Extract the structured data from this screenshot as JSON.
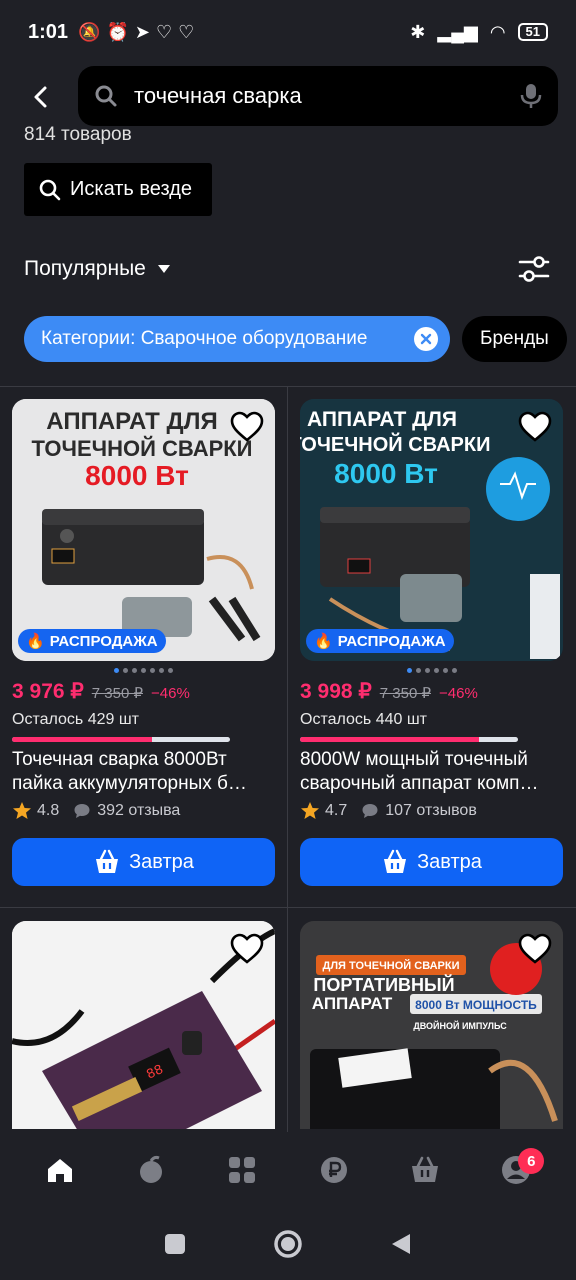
{
  "status": {
    "time": "1:01",
    "battery": "51"
  },
  "search": {
    "query": "точечная сварка"
  },
  "results": {
    "count_text": "814 товаров",
    "search_everywhere": "Искать везде"
  },
  "sort": {
    "label": "Популярные"
  },
  "chips": {
    "category": "Категории: Сварочное оборудование",
    "brands": "Бренды"
  },
  "products": [
    {
      "sale_badge": "РАСПРОДАЖА",
      "price": "3 976 ₽",
      "old_price": "7 350 ₽",
      "discount": "−46%",
      "stock": "Осталось 429 шт",
      "stock_fraction": 0.64,
      "title": "Точечная сварка 8000Вт пайка аккумуляторных б…",
      "rating": "4.8",
      "reviews": "392 отзыва",
      "buy_label": "Завтра",
      "image_text_1": "АППАРАТ ДЛЯ",
      "image_text_2": "ТОЧЕЧНОЙ СВАРКИ",
      "image_text_3": "8000 Вт",
      "image_bg": "#e8e8e8"
    },
    {
      "sale_badge": "РАСПРОДАЖА",
      "price": "3 998 ₽",
      "old_price": "7 350 ₽",
      "discount": "−46%",
      "stock": "Осталось 440 шт",
      "stock_fraction": 0.82,
      "title": "8000W мощный точечный сварочный аппарат комп…",
      "rating": "4.7",
      "reviews": "107 отзывов",
      "buy_label": "Завтра",
      "image_text_1": "АППАРАТ ДЛЯ",
      "image_text_2": "ТОЧЕЧНОЙ СВАРКИ",
      "image_text_3": "8000 Вт",
      "image_bg": "#15303d"
    },
    {
      "image_bg": "#f2f2f2"
    },
    {
      "image_text_1": "ДЛЯ ТОЧЕЧНОЙ СВАРКИ",
      "image_text_2": "ПОРТАТИВНЫЙ",
      "image_text_3": "АППАРАТ",
      "image_text_4": "8000 Вт МОЩНОСТЬ",
      "image_text_5": "ДВОЙНОЙ ИМПУЛЬС",
      "image_bg": "#2c2c2e"
    }
  ],
  "nav": {
    "cart_badge": "6"
  }
}
